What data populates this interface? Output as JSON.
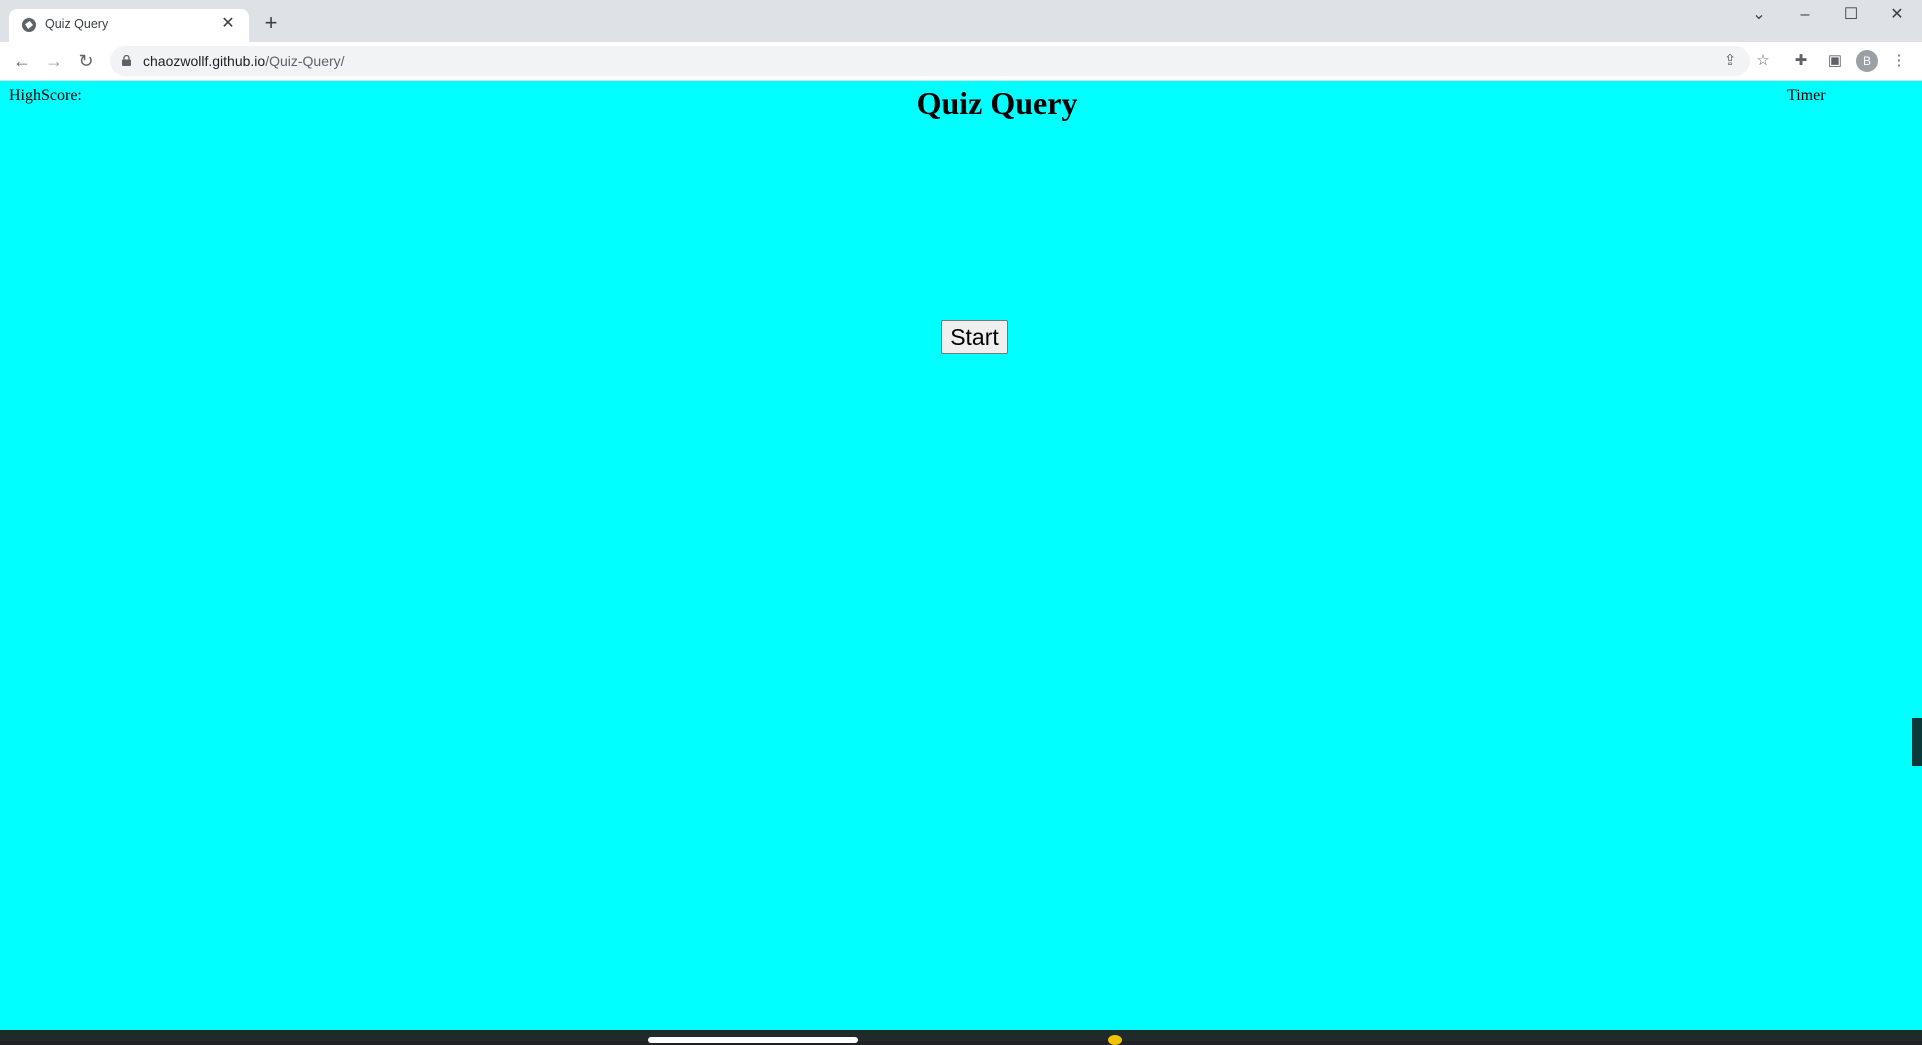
{
  "browser": {
    "tab": {
      "title": "Quiz Query",
      "favicon_icon": "globe-icon",
      "close_icon": "close-icon"
    },
    "new_tab_icon": "plus-icon",
    "window_controls": [
      "chevron-down-icon",
      "minimize-icon",
      "maximize-icon",
      "close-icon"
    ],
    "address_bar": {
      "host": "chaozwollf.github.io",
      "path": "/Quiz-Query/"
    },
    "profile_initial": "B"
  },
  "page": {
    "background_color": "#00ffff",
    "highscore_label": "HighScore:",
    "title": "Quiz Query",
    "timer_label": "Timer",
    "start_button_label": "Start"
  }
}
